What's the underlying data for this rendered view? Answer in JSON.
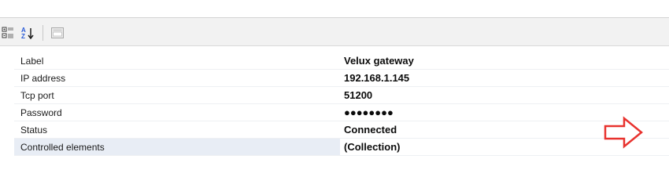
{
  "toolbar": {
    "buttons": [
      {
        "icon": "categorized-view-icon"
      },
      {
        "icon": "sort-alphabetical-icon"
      },
      {
        "icon": "property-pages-icon"
      }
    ]
  },
  "properties": [
    {
      "label": "Label",
      "value": "Velux gateway"
    },
    {
      "label": "IP address",
      "value": "192.168.1.145"
    },
    {
      "label": "Tcp port",
      "value": "51200"
    },
    {
      "label": "Password",
      "value": "●●●●●●●●"
    },
    {
      "label": "Status",
      "value": "Connected"
    },
    {
      "label": "Controlled elements",
      "value": "(Collection)"
    }
  ],
  "annotation": {
    "arrow_color": "#e8322e",
    "icon": "pointer-arrow-icon"
  }
}
